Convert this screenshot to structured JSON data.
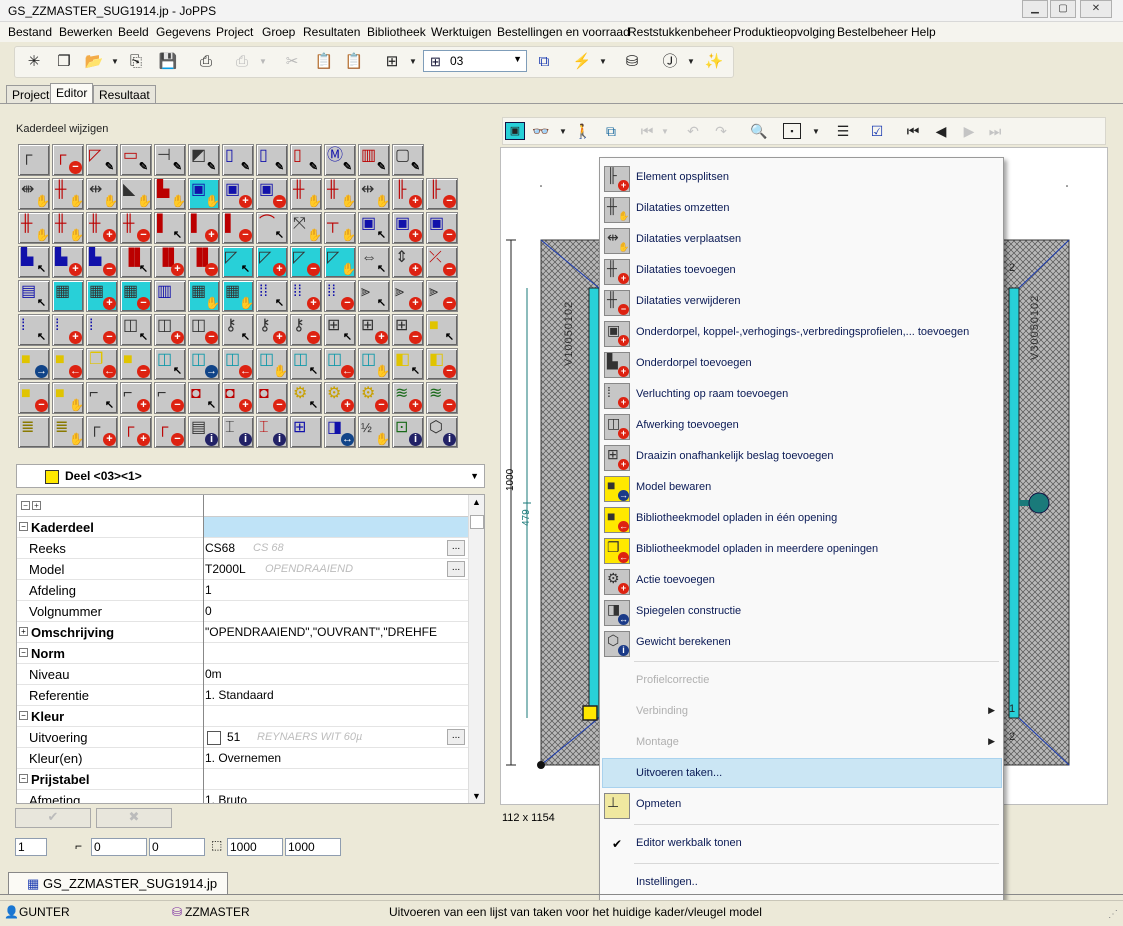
{
  "window": {
    "title": "GS_ZZMASTER_SUG1914.jp - JoPPS",
    "buttons": [
      "minimize-icon",
      "maximize-icon",
      "close-icon"
    ]
  },
  "menubar": [
    "Bestand",
    "Bewerken",
    "Beeld",
    "Gegevens",
    "Project",
    "Groep",
    "Resultaten",
    "Bibliotheek",
    "Werktuigen",
    "Bestellingen en voorraad",
    "Reststukkenbeheer",
    "Produktieopvolging",
    "Bestelbeheer",
    "Help"
  ],
  "toolbar": {
    "view_value": "03"
  },
  "tabs": [
    "Project",
    "Editor",
    "Resultaat"
  ],
  "editor": {
    "panel_title": "Kaderdeel wijzigen",
    "deel_select": "Deel <03><1>",
    "properties": [
      {
        "type": "cat",
        "toggle": "⊟",
        "label": "Kaderdeel"
      },
      {
        "label": "Reeks",
        "value": "CS68",
        "ghost": "CS 68",
        "ellipsis": true
      },
      {
        "label": "Model",
        "value": "T2000L",
        "ghost": "OPENDRAAIEND",
        "ellipsis": true
      },
      {
        "label": "Afdeling",
        "value": "1"
      },
      {
        "label": "Volgnummer",
        "value": "0"
      },
      {
        "type": "cat",
        "toggle": "⊞",
        "label": "Omschrijving",
        "value": "\"OPENDRAAIEND\",\"OUVRANT\",\"DREHFE"
      },
      {
        "type": "cat",
        "toggle": "⊟",
        "label": "Norm"
      },
      {
        "label": "Niveau",
        "value": "0m"
      },
      {
        "label": "Referentie",
        "value": "1. Standaard"
      },
      {
        "type": "cat",
        "toggle": "⊟",
        "label": "Kleur"
      },
      {
        "label": "Uitvoering",
        "value": "51",
        "ghost": "REYNAERS WIT 60µ",
        "ellipsis": true,
        "checkbox": true
      },
      {
        "label": "Kleur(en)",
        "value": "1. Overnemen"
      },
      {
        "type": "cat",
        "toggle": "⊟",
        "label": "Prijstabel"
      },
      {
        "label": "Afmeting",
        "value": "1. Bruto"
      }
    ],
    "ok_symbol": "✔",
    "cancel_symbol": "✖",
    "inputs": [
      "1",
      "0",
      "0",
      "1000",
      "1000"
    ],
    "canvas_dims": "112 x 1154",
    "drawing": {
      "dim_outer": "1000",
      "dim_inner": "479",
      "profile_left": "V10050102",
      "profile_right": "V30050102",
      "mark_2_top": "2",
      "mark_2_bottom": "2",
      "mark_1": "1"
    }
  },
  "context_menu": {
    "items": [
      {
        "label": "Element opsplitsen",
        "icon": "split-element-icon",
        "glyph": "╟",
        "badge": "+"
      },
      {
        "label": "Dilataties omzetten",
        "icon": "convert-dilatations-icon",
        "glyph": "╫",
        "badge": "✋"
      },
      {
        "label": "Dilataties verplaatsen",
        "icon": "move-dilatations-icon",
        "glyph": "⇹",
        "badge": "✋"
      },
      {
        "label": "Dilataties toevoegen",
        "icon": "add-dilatations-icon",
        "glyph": "╫",
        "badge": "+"
      },
      {
        "label": "Dilataties verwijderen",
        "icon": "remove-dilatations-icon",
        "glyph": "╫",
        "badge": "−"
      },
      {
        "label": "Onderdorpel, koppel-,verhogings-,verbredingsprofielen,... toevoegen",
        "icon": "add-profiles-icon",
        "glyph": "▣",
        "badge": "+"
      },
      {
        "label": "Onderdorpel toevoegen",
        "icon": "add-sill-icon",
        "glyph": "▙",
        "badge": "+"
      },
      {
        "label": "Verluchting op raam toevoegen",
        "icon": "add-ventilation-icon",
        "glyph": "⁞",
        "badge": "+"
      },
      {
        "label": "Afwerking toevoegen",
        "icon": "add-finishing-icon",
        "glyph": "◫",
        "badge": "+"
      },
      {
        "label": "Draaizin onafhankelijk beslag toevoegen",
        "icon": "add-hardware-icon",
        "glyph": "⊞",
        "badge": "+"
      },
      {
        "label": "Model bewaren",
        "icon": "save-model-icon",
        "glyph": "■",
        "badge": "→",
        "yellow": true
      },
      {
        "label": "Bibliotheekmodel opladen in één opening",
        "icon": "load-library-model-single-icon",
        "glyph": "■",
        "badge": "←",
        "yellow": true
      },
      {
        "label": "Bibliotheekmodel opladen in meerdere openingen",
        "icon": "load-library-model-multiple-icon",
        "glyph": "❐",
        "badge": "←",
        "yellow": true
      },
      {
        "label": "Actie toevoegen",
        "icon": "add-action-icon",
        "glyph": "⚙",
        "badge": "+"
      },
      {
        "label": "Spiegelen constructie",
        "icon": "mirror-construction-icon",
        "glyph": "◨",
        "badge": "↔"
      },
      {
        "label": "Gewicht berekenen",
        "icon": "calculate-weight-icon",
        "glyph": "⬡",
        "badge": "i"
      }
    ],
    "disabled_items": [
      "Profielcorrectie",
      "Verbinding",
      "Montage"
    ],
    "uitvoeren": "Uitvoeren taken...",
    "opmeten": "Opmeten",
    "editor_toolbar_toggle": "Editor werkbalk tonen",
    "instellingen": "Instellingen.."
  },
  "doc_tab": "GS_ZZMASTER_SUG1914.jp",
  "status": {
    "user": "GUNTER",
    "db": "ZZMASTER",
    "message": "Uitvoeren van een lijst van taken voor het huidige kader/vleugel model"
  }
}
